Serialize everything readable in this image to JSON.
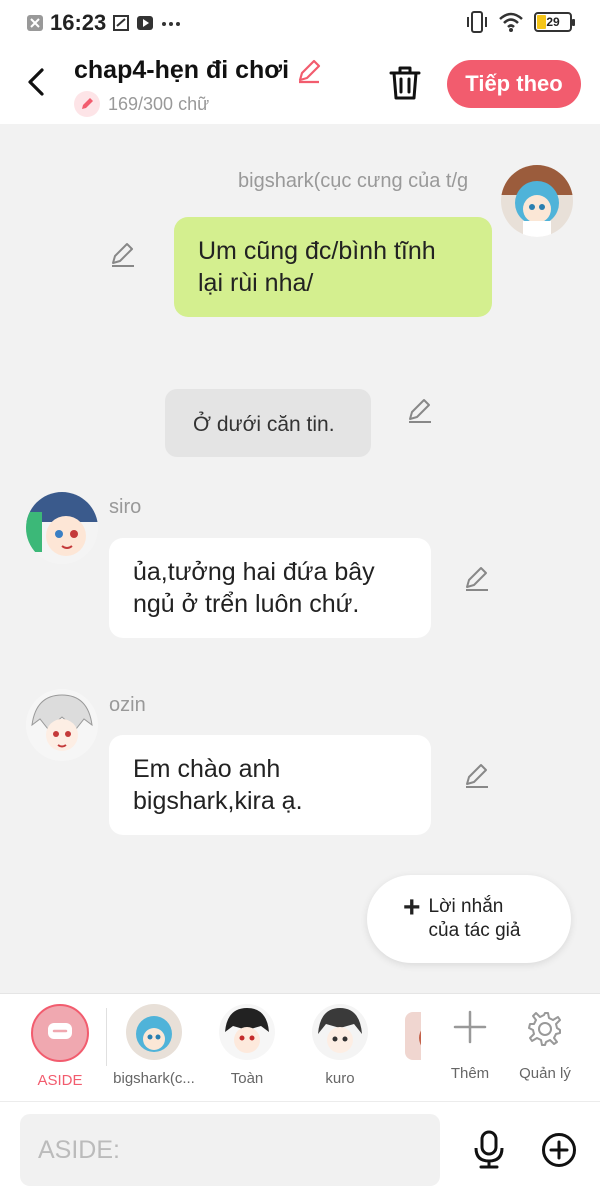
{
  "status_bar": {
    "time": "16:23",
    "battery": "29",
    "battery_level": 0.29
  },
  "header": {
    "title": "chap4-hẹn đi chơi",
    "word_count": "169/300 chữ",
    "next_label": "Tiếp theo"
  },
  "messages": [
    {
      "speaker": "bigshark(cục cưng của t/g",
      "text": "Um cũng đc/bình tĩnh\nlại rùi nha/"
    },
    {
      "text": "Ở dưới căn tin."
    },
    {
      "speaker": "siro",
      "text": "ủa,tưởng hai đứa bây\nngủ ở trển luôn chứ."
    },
    {
      "speaker": "ozin",
      "text": "Em chào anh\nbigshark,kira ạ."
    }
  ],
  "author_note": {
    "label": "Lời nhắn\ncủa tác giả"
  },
  "characters": [
    {
      "label": "ASIDE"
    },
    {
      "label": "bigshark(c..."
    },
    {
      "label": "Toàn"
    },
    {
      "label": "kuro"
    }
  ],
  "actions": {
    "add_label": "Thêm",
    "manage_label": "Quản lý"
  },
  "input": {
    "placeholder": "ASIDE:"
  },
  "colors": {
    "accent": "#f25c6e",
    "bubble_self": "#d4ef8f",
    "background": "#f2f2f2"
  }
}
